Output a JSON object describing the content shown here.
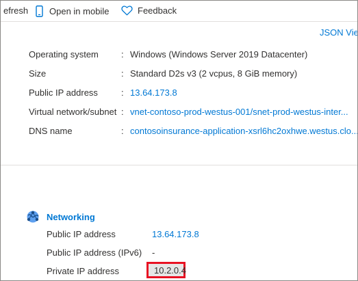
{
  "toolbar": {
    "refresh_label": "efresh",
    "open_mobile_label": "Open in mobile",
    "feedback_label": "Feedback",
    "refresh_icon": "refresh-icon",
    "mobile_icon": "mobile-phone-icon",
    "feedback_icon": "heart-icon"
  },
  "json_view_label": "JSON View",
  "properties": [
    {
      "label": "Operating system",
      "value": "Windows (Windows Server 2019 Datacenter)"
    },
    {
      "label": "Size",
      "value": "Standard D2s v3 (2 vcpus, 8 GiB memory)"
    },
    {
      "label": "Public IP address",
      "value": "13.64.173.8"
    },
    {
      "label": "Virtual network/subnet",
      "value": "vnet-contoso-prod-westus-001/snet-prod-westus-inter..."
    },
    {
      "label": "DNS name",
      "value": "contosoinsurance-application-xsrl6hc2oxhwe.westus.clo..."
    }
  ],
  "colon": ":",
  "networking": {
    "title": "Networking",
    "icon": "networking-globe-icon",
    "rows": [
      {
        "label": "Public IP address",
        "value": "13.64.173.8"
      },
      {
        "label": "Public IP address (IPv6)",
        "value": "-"
      },
      {
        "label": "Private IP address",
        "value": "10.2.0.4"
      }
    ]
  },
  "colors": {
    "link": "#0078d4",
    "highlight_border": "#e81123",
    "text": "#323130"
  }
}
